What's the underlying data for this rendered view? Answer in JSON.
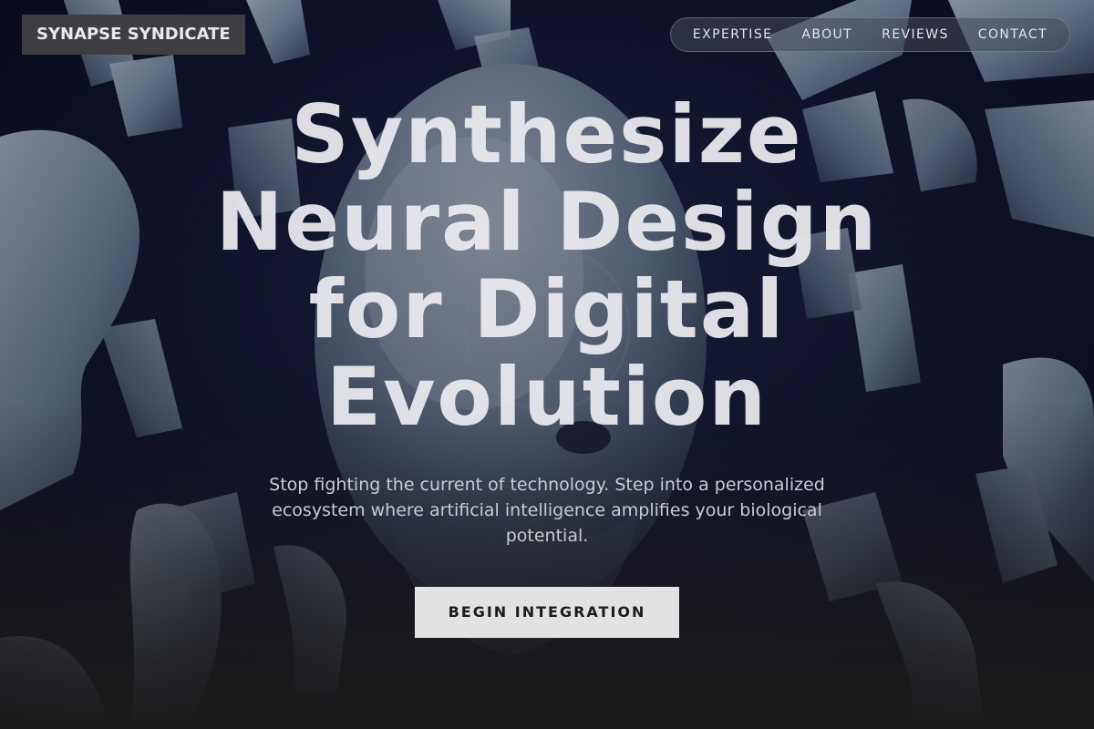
{
  "brand": {
    "name": "SYNAPSE SYNDICATE"
  },
  "nav": {
    "items": [
      {
        "label": "EXPERTISE"
      },
      {
        "label": "ABOUT"
      },
      {
        "label": "REVIEWS"
      },
      {
        "label": "CONTACT"
      }
    ]
  },
  "hero": {
    "title": "Synthesize Neural Design for Digital Evolution",
    "subtitle": "Stop fighting the current of technology. Step into a personalized ecosystem where artificial intelligence amplifies your biological potential.",
    "cta_label": "BEGIN INTEGRATION"
  },
  "colors": {
    "background": "#0c0f24",
    "logo_bg": "#3e3e42",
    "cta_bg": "#e2e2e4",
    "robot_body": "#a9bccd"
  },
  "background_image": {
    "icon": "robot-crowd-illustration"
  }
}
